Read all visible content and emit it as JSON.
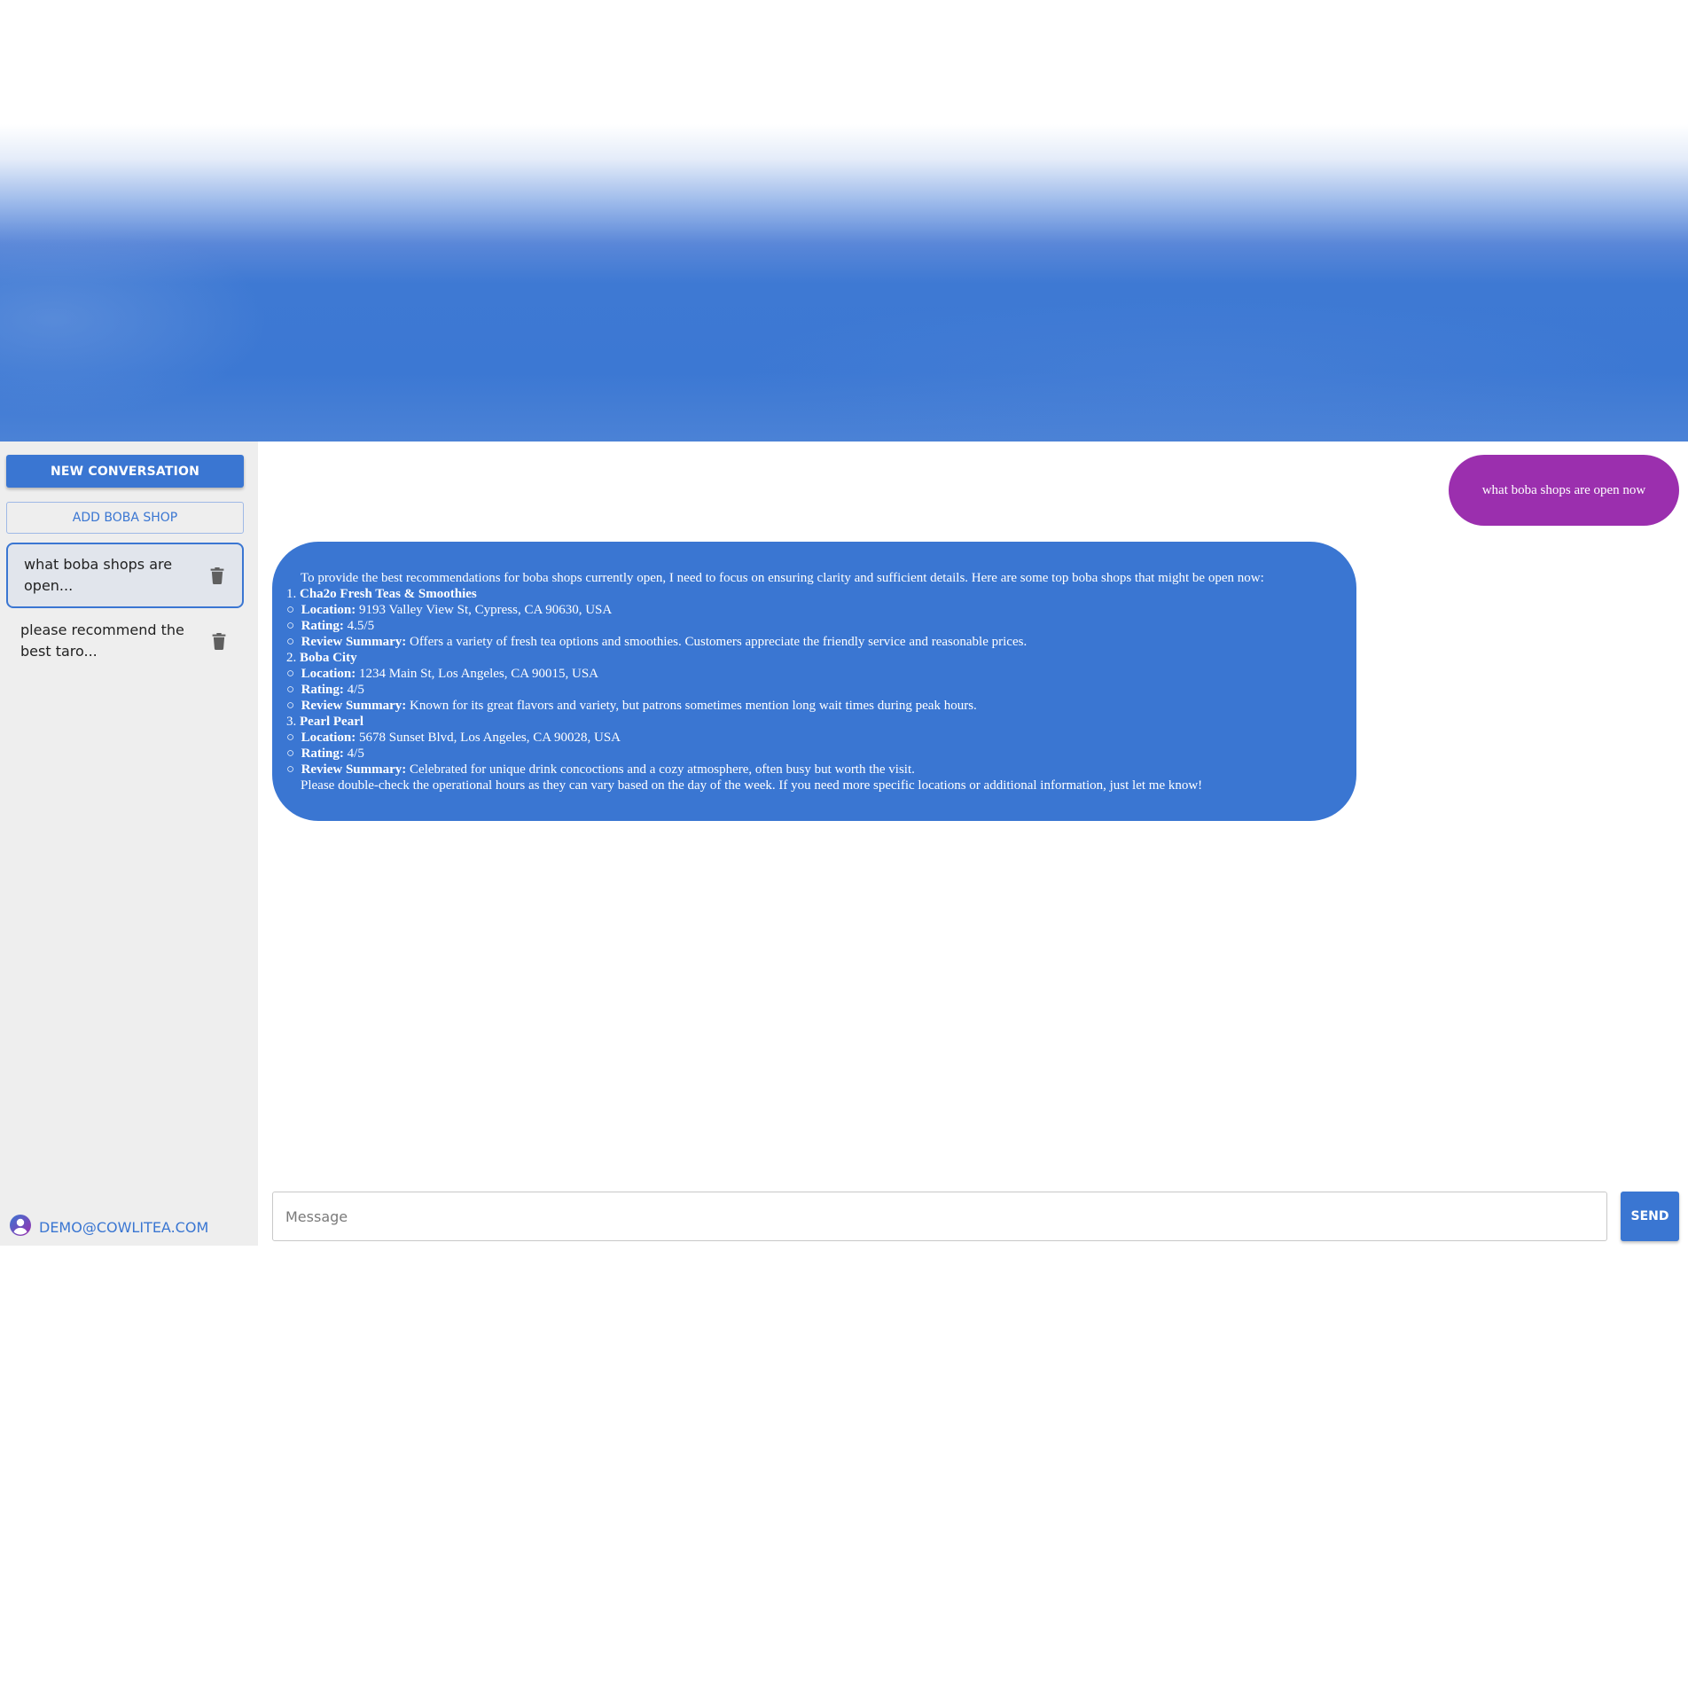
{
  "sidebar": {
    "new_conversation_label": "NEW CONVERSATION",
    "add_shop_label": "ADD BOBA SHOP",
    "conversations": [
      {
        "label": "what boba shops are\nopen...",
        "active": true
      },
      {
        "label": "please recommend the\nbest taro...",
        "active": false
      }
    ],
    "user_email": "DEMO@COWLITEA.COM"
  },
  "chat": {
    "user_message": "what boba shops are open now",
    "bot": {
      "intro": "To provide the best recommendations for boba shops currently open, I need to focus on ensuring clarity and sufficient details. Here are some top boba shops that might be open now:",
      "shops": [
        {
          "number": "1.",
          "name": "Cha2o Fresh Teas & Smoothies",
          "location_label": "Location:",
          "location": "9193 Valley View St, Cypress, CA 90630, USA",
          "rating_label": "Rating:",
          "rating": "4.5/5",
          "review_label": "Review Summary:",
          "review": "Offers a variety of fresh tea options and smoothies. Customers appreciate the friendly service and reasonable prices."
        },
        {
          "number": "2.",
          "name": "Boba City",
          "location_label": "Location:",
          "location": "1234 Main St, Los Angeles, CA 90015, USA",
          "rating_label": "Rating:",
          "rating": "4/5",
          "review_label": "Review Summary:",
          "review": "Known for its great flavors and variety, but patrons sometimes mention long wait times during peak hours."
        },
        {
          "number": "3.",
          "name": "Pearl Pearl",
          "location_label": "Location:",
          "location": "5678 Sunset Blvd, Los Angeles, CA 90028, USA",
          "rating_label": "Rating:",
          "rating": "4/5",
          "review_label": "Review Summary:",
          "review": "Celebrated for unique drink concoctions and a cozy atmosphere, often busy but worth the visit."
        }
      ],
      "closing": "Please double-check the operational hours as they can vary based on the day of the week. If you need more specific locations or additional information, just let me know!"
    }
  },
  "composer": {
    "placeholder": "Message",
    "value": "",
    "send_label": "SEND"
  },
  "icons": {
    "trash": "trash-icon",
    "user": "user-avatar-icon",
    "bullet": "hollow-circle-bullet"
  },
  "colors": {
    "primary": "#3a76d2",
    "user_bubble": "#9b2fae",
    "sidebar_bg": "#eeeeee",
    "active_conv_bg": "#e1e5ec"
  }
}
